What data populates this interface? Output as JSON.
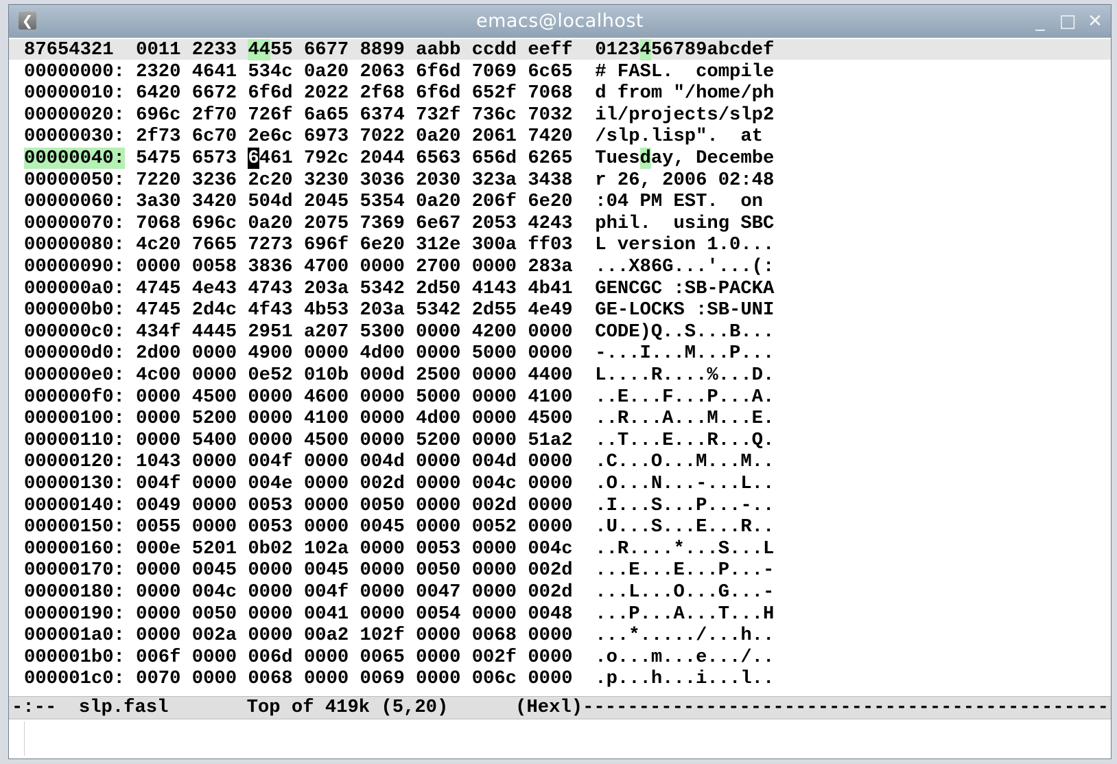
{
  "window": {
    "title": "emacs@localhost",
    "app_icon": "emacs-app-icon",
    "controls": {
      "minimize": "_",
      "maximize": "□",
      "close": "✕"
    }
  },
  "hexl": {
    "header": {
      "address": "87654321",
      "hex_columns": [
        "0011",
        "2233",
        "4455",
        "6677",
        "8899",
        "aabb",
        "ccdd",
        "eeff"
      ],
      "ascii": "0123456789abcdef"
    },
    "rows": [
      {
        "address": "00000000:",
        "hex": [
          "2320",
          "4641",
          "534c",
          "0a20",
          "2063",
          "6f6d",
          "7069",
          "6c65"
        ],
        "ascii": "# FASL.  compile"
      },
      {
        "address": "00000010:",
        "hex": [
          "6420",
          "6672",
          "6f6d",
          "2022",
          "2f68",
          "6f6d",
          "652f",
          "7068"
        ],
        "ascii": "d from \"/home/ph"
      },
      {
        "address": "00000020:",
        "hex": [
          "696c",
          "2f70",
          "726f",
          "6a65",
          "6374",
          "732f",
          "736c",
          "7032"
        ],
        "ascii": "il/projects/slp2"
      },
      {
        "address": "00000030:",
        "hex": [
          "2f73",
          "6c70",
          "2e6c",
          "6973",
          "7022",
          "0a20",
          "2061",
          "7420"
        ],
        "ascii": "/slp.lisp\".  at "
      },
      {
        "address": "00000040:",
        "hex": [
          "5475",
          "6573",
          "6461",
          "792c",
          "2044",
          "6563",
          "656d",
          "6265"
        ],
        "ascii": "Tuesday, Decembe"
      },
      {
        "address": "00000050:",
        "hex": [
          "7220",
          "3236",
          "2c20",
          "3230",
          "3036",
          "2030",
          "323a",
          "3438"
        ],
        "ascii": "r 26, 2006 02:48"
      },
      {
        "address": "00000060:",
        "hex": [
          "3a30",
          "3420",
          "504d",
          "2045",
          "5354",
          "0a20",
          "206f",
          "6e20"
        ],
        "ascii": ":04 PM EST.  on "
      },
      {
        "address": "00000070:",
        "hex": [
          "7068",
          "696c",
          "0a20",
          "2075",
          "7369",
          "6e67",
          "2053",
          "4243"
        ],
        "ascii": "phil.  using SBC"
      },
      {
        "address": "00000080:",
        "hex": [
          "4c20",
          "7665",
          "7273",
          "696f",
          "6e20",
          "312e",
          "300a",
          "ff03"
        ],
        "ascii": "L version 1.0..."
      },
      {
        "address": "00000090:",
        "hex": [
          "0000",
          "0058",
          "3836",
          "4700",
          "0000",
          "2700",
          "0000",
          "283a"
        ],
        "ascii": "...X86G...'...(:"
      },
      {
        "address": "000000a0:",
        "hex": [
          "4745",
          "4e43",
          "4743",
          "203a",
          "5342",
          "2d50",
          "4143",
          "4b41"
        ],
        "ascii": "GENCGC :SB-PACKA"
      },
      {
        "address": "000000b0:",
        "hex": [
          "4745",
          "2d4c",
          "4f43",
          "4b53",
          "203a",
          "5342",
          "2d55",
          "4e49"
        ],
        "ascii": "GE-LOCKS :SB-UNI"
      },
      {
        "address": "000000c0:",
        "hex": [
          "434f",
          "4445",
          "2951",
          "a207",
          "5300",
          "0000",
          "4200",
          "0000"
        ],
        "ascii": "CODE)Q..S...B..."
      },
      {
        "address": "000000d0:",
        "hex": [
          "2d00",
          "0000",
          "4900",
          "0000",
          "4d00",
          "0000",
          "5000",
          "0000"
        ],
        "ascii": "-...I...M...P..."
      },
      {
        "address": "000000e0:",
        "hex": [
          "4c00",
          "0000",
          "0e52",
          "010b",
          "000d",
          "2500",
          "0000",
          "4400"
        ],
        "ascii": "L....R....%...D."
      },
      {
        "address": "000000f0:",
        "hex": [
          "0000",
          "4500",
          "0000",
          "4600",
          "0000",
          "5000",
          "0000",
          "4100"
        ],
        "ascii": "..E...F...P...A."
      },
      {
        "address": "00000100:",
        "hex": [
          "0000",
          "5200",
          "0000",
          "4100",
          "0000",
          "4d00",
          "0000",
          "4500"
        ],
        "ascii": "..R...A...M...E."
      },
      {
        "address": "00000110:",
        "hex": [
          "0000",
          "5400",
          "0000",
          "4500",
          "0000",
          "5200",
          "0000",
          "51a2"
        ],
        "ascii": "..T...E...R...Q."
      },
      {
        "address": "00000120:",
        "hex": [
          "1043",
          "0000",
          "004f",
          "0000",
          "004d",
          "0000",
          "004d",
          "0000"
        ],
        "ascii": ".C...O...M...M.."
      },
      {
        "address": "00000130:",
        "hex": [
          "004f",
          "0000",
          "004e",
          "0000",
          "002d",
          "0000",
          "004c",
          "0000"
        ],
        "ascii": ".O...N...-...L.."
      },
      {
        "address": "00000140:",
        "hex": [
          "0049",
          "0000",
          "0053",
          "0000",
          "0050",
          "0000",
          "002d",
          "0000"
        ],
        "ascii": ".I...S...P...-.."
      },
      {
        "address": "00000150:",
        "hex": [
          "0055",
          "0000",
          "0053",
          "0000",
          "0045",
          "0000",
          "0052",
          "0000"
        ],
        "ascii": ".U...S...E...R.."
      },
      {
        "address": "00000160:",
        "hex": [
          "000e",
          "5201",
          "0b02",
          "102a",
          "0000",
          "0053",
          "0000",
          "004c"
        ],
        "ascii": "..R....*...S...L"
      },
      {
        "address": "00000170:",
        "hex": [
          "0000",
          "0045",
          "0000",
          "0045",
          "0000",
          "0050",
          "0000",
          "002d"
        ],
        "ascii": "...E...E...P...-"
      },
      {
        "address": "00000180:",
        "hex": [
          "0000",
          "004c",
          "0000",
          "004f",
          "0000",
          "0047",
          "0000",
          "002d"
        ],
        "ascii": "...L...O...G...-"
      },
      {
        "address": "00000190:",
        "hex": [
          "0000",
          "0050",
          "0000",
          "0041",
          "0000",
          "0054",
          "0000",
          "0048"
        ],
        "ascii": "...P...A...T...H"
      },
      {
        "address": "000001a0:",
        "hex": [
          "0000",
          "002a",
          "0000",
          "00a2",
          "102f",
          "0000",
          "0068",
          "0000"
        ],
        "ascii": "...*...../...h.."
      },
      {
        "address": "000001b0:",
        "hex": [
          "006f",
          "0000",
          "006d",
          "0000",
          "0065",
          "0000",
          "002f",
          "0000"
        ],
        "ascii": ".o...m...e.../.."
      },
      {
        "address": "000001c0:",
        "hex": [
          "0070",
          "0000",
          "0068",
          "0000",
          "0069",
          "0000",
          "006c",
          "0000"
        ],
        "ascii": ".p...h...i...l.."
      }
    ],
    "cursor_row": 4,
    "cursor_hex_column": 2,
    "cursor_ascii_index": 4
  },
  "modeline": {
    "text": "-:--  slp.fasl       Top of 419k (5,20)      (Hexl)------------------------------------------------------------"
  },
  "colors": {
    "highlight": "#b5f0b5",
    "cursor_bg": "#000000",
    "titlebar": "#9fb1c2",
    "modeline_bg": "#dfdfdf"
  }
}
